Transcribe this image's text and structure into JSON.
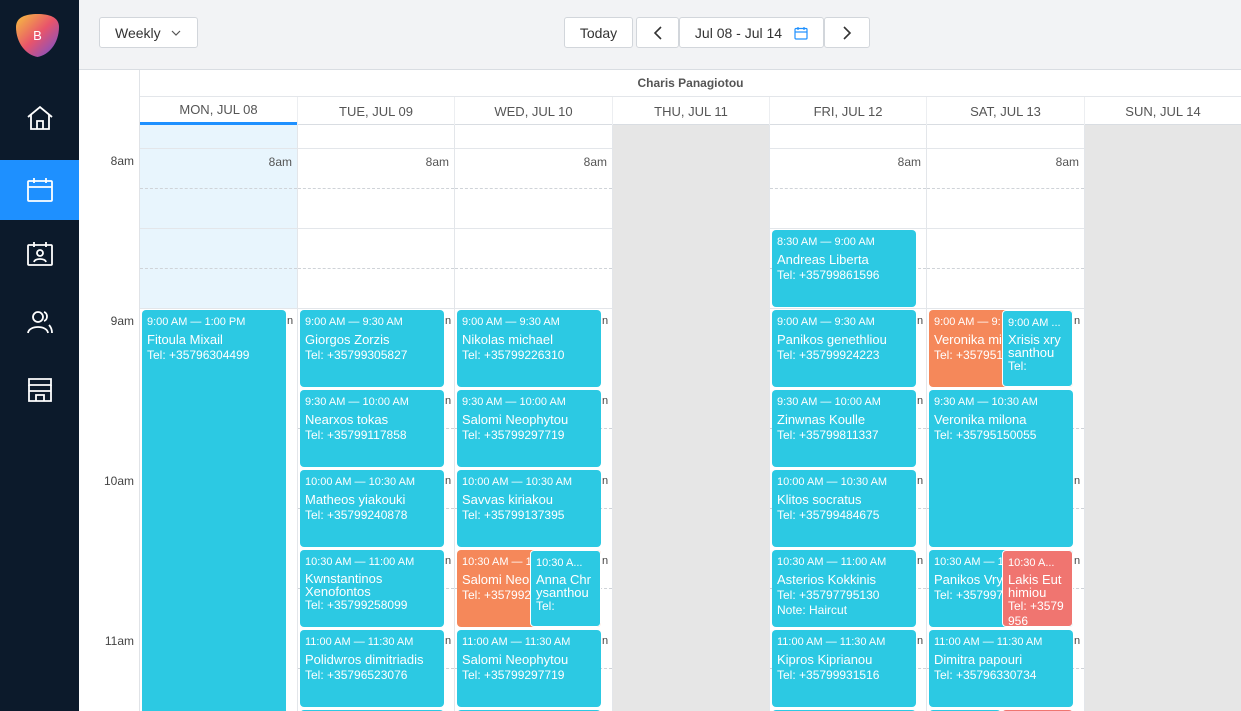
{
  "app": {
    "logo_letter": "B"
  },
  "nav": {
    "items": [
      {
        "name": "home",
        "icon": "home-icon"
      },
      {
        "name": "calendar",
        "icon": "calendar-icon",
        "active": true
      },
      {
        "name": "appointments",
        "icon": "calendar-person-icon"
      },
      {
        "name": "clients",
        "icon": "users-icon"
      },
      {
        "name": "shop",
        "icon": "store-icon"
      }
    ]
  },
  "toolbar": {
    "view_label": "Weekly",
    "today_label": "Today",
    "range_label": "Jul 08 - Jul 14"
  },
  "calendar": {
    "staff_name": "Charis Panagiotou",
    "days": [
      "MON, JUL 08",
      "TUE, JUL 09",
      "WED, JUL 10",
      "THU, JUL 11",
      "FRI, JUL 12",
      "SAT, JUL 13",
      "SUN, JUL 14"
    ],
    "hours": [
      "8am",
      "9am",
      "10am",
      "11am"
    ],
    "col_time_label": "8am",
    "overflow_marker": "n"
  },
  "appointments": {
    "mon": [
      {
        "time": "9:00 AM — 1:00 PM",
        "name": "Fitoula Mixail",
        "phone": "Tel: +35796304499",
        "color": "#2cc9e3"
      }
    ],
    "tue": [
      {
        "time": "9:00 AM — 9:30 AM",
        "name": "Giorgos Zorzis",
        "phone": "Tel: +35799305827"
      },
      {
        "time": "9:30 AM — 10:00 AM",
        "name": "Nearxos tokas",
        "phone": "Tel: +35799117858"
      },
      {
        "time": "10:00 AM — 10:30 AM",
        "name": "Matheos yiakouki",
        "phone": "Tel: +35799240878"
      },
      {
        "time": "10:30 AM — 11:00 AM",
        "name": "Kwnstantinos Xenofontos",
        "phone": "Tel: +35799258099"
      },
      {
        "time": "11:00 AM — 11:30 AM",
        "name": "Polidwros dimitriadis",
        "phone": "Tel: +35796523076"
      }
    ],
    "wed": [
      {
        "time": "9:00 AM — 9:30 AM",
        "name": "Nikolas michael",
        "phone": "Tel: +35799226310"
      },
      {
        "time": "9:30 AM — 10:00 AM",
        "name": "Salomi Neophytou",
        "phone": "Tel: +35799297719"
      },
      {
        "time": "10:00 AM — 10:30 AM",
        "name": "Savvas kiriakou",
        "phone": "Tel: +35799137395"
      },
      {
        "time": "10:30 AM — 1",
        "name": "Salomi Neop",
        "phone": "Tel: +3579929"
      },
      {
        "time": "10:30 A...",
        "name": "Anna Chrysanthou",
        "phone": "Tel:"
      },
      {
        "time": "11:00 AM — 11:30 AM",
        "name": "Salomi Neophytou",
        "phone": "Tel: +35799297719"
      }
    ],
    "fri": [
      {
        "time": "8:30 AM — 9:00 AM",
        "name": "Andreas Liberta",
        "phone": "Tel: +35799861596"
      },
      {
        "time": "9:00 AM — 9:30 AM",
        "name": "Panikos genethliou",
        "phone": "Tel: +35799924223"
      },
      {
        "time": "9:30 AM — 10:00 AM",
        "name": "Zinwnas Koulle",
        "phone": "Tel: +35799811337"
      },
      {
        "time": "10:00 AM — 10:30 AM",
        "name": "Klitos socratus",
        "phone": "Tel: +35799484675"
      },
      {
        "time": "10:30 AM — 11:00 AM",
        "name": "Asterios Kokkinis",
        "phone": "Tel: +35797795130",
        "note": "Note: Haircut"
      },
      {
        "time": "11:00 AM — 11:30 AM",
        "name": "Kipros Kiprianou",
        "phone": "Tel: +35799931516"
      }
    ],
    "sat": [
      {
        "time": "9:00 AM — 9:",
        "name": "Veronika mi",
        "phone": "Tel: +357951"
      },
      {
        "time": "9:00 AM ...",
        "name": "Xrisis xrysanthou",
        "phone": "Tel:"
      },
      {
        "time": "9:30 AM — 10:30 AM",
        "name": "Veronika milona",
        "phone": "Tel: +35795150055"
      },
      {
        "time": "10:30 AM — 1",
        "name": "Panikos Vry",
        "phone": "Tel: +357997"
      },
      {
        "time": "10:30 A...",
        "name": "Lakis Euthimiou",
        "phone": "Tel: +3579956"
      },
      {
        "time": "11:00 AM — 11:30 AM",
        "name": "Dimitra papouri",
        "phone": "Tel: +35796330734"
      }
    ]
  },
  "colors": {
    "blue": "#2cc9e3",
    "orange": "#f5885a",
    "red": "#f07570",
    "accent": "#1e90ff",
    "sidebar": "#0c1a2b"
  }
}
